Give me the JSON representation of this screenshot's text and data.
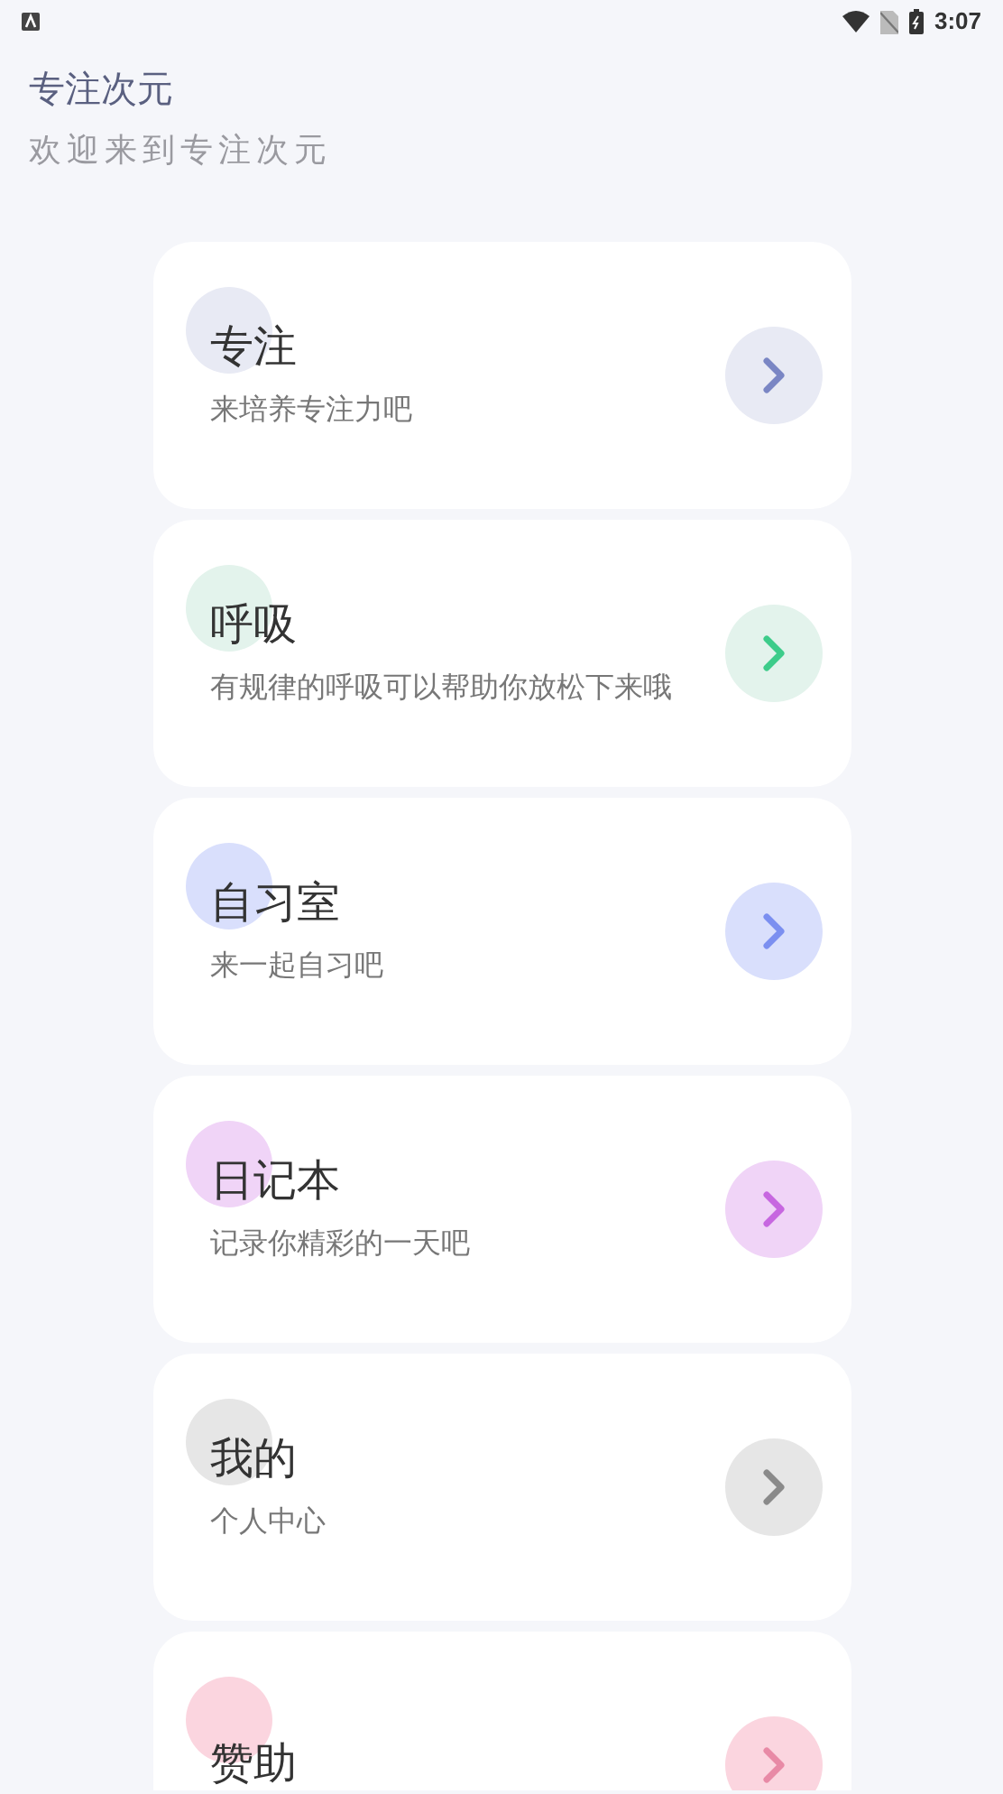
{
  "status_bar": {
    "time": "3:07"
  },
  "header": {
    "title": "专注次元",
    "subtitle": "欢迎来到专注次元"
  },
  "cards": [
    {
      "title": "专注",
      "subtitle": "来培养专注力吧",
      "color": "#e8eaf4",
      "arrow": {
        "color": "#7a86c4"
      }
    },
    {
      "title": "呼吸",
      "subtitle": "有规律的呼吸可以帮助你放松下来哦",
      "color": "#e3f3ec",
      "arrow": {
        "color": "#3dcc8a"
      }
    },
    {
      "title": "自习室",
      "subtitle": "来一起自习吧",
      "color": "#d9dffc",
      "arrow": {
        "color": "#7b8ff0"
      }
    },
    {
      "title": "日记本",
      "subtitle": "记录你精彩的一天吧",
      "color": "#f0d4f7",
      "arrow": {
        "color": "#c767e0"
      }
    },
    {
      "title": "我的",
      "subtitle": "个人中心",
      "color": "#e6e6e6",
      "arrow": {
        "color": "#8a8a8a"
      }
    },
    {
      "title": "赞助",
      "color": "#fbd5df",
      "arrow": {
        "color": "#e88aa6"
      }
    }
  ]
}
